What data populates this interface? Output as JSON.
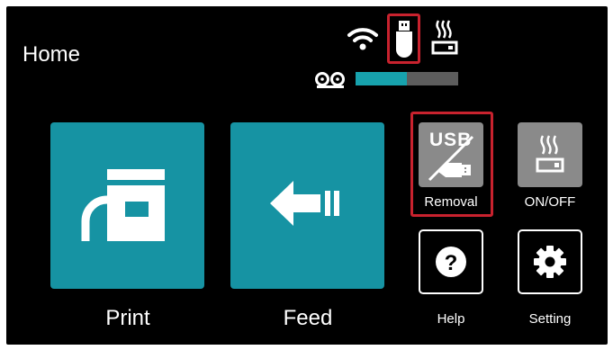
{
  "header": {
    "title": "Home"
  },
  "status": {
    "wifi_icon": "wifi-icon",
    "usb_icon": "usb-drive-icon",
    "heater_icon": "heater-icon",
    "media_icon": "paper-roll-icon",
    "media_level": 0.5
  },
  "tiles": {
    "print_label": "Print",
    "feed_label": "Feed",
    "usb_removal_label": "Removal",
    "usb_removal_text": "USB",
    "onoff_label": "ON/OFF",
    "help_label": "Help",
    "setting_label": "Setting"
  },
  "colors": {
    "background": "#000000",
    "tile_teal": "#1693a3",
    "tile_grey": "#8a8a8a",
    "highlight_red": "#c8222e",
    "media_fill": "#17a2ad",
    "media_track": "#5d5d5d"
  }
}
